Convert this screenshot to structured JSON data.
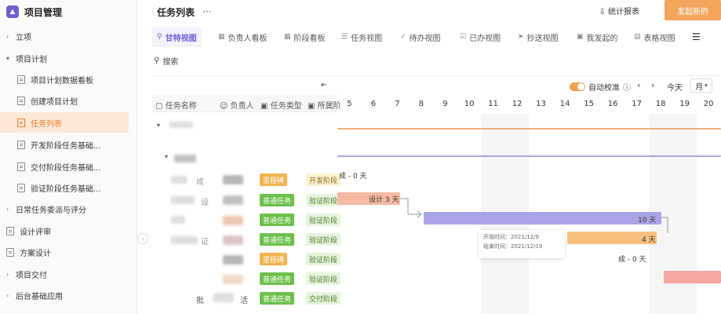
{
  "sidebar": {
    "title": "项目管理",
    "items": [
      {
        "label": "立项"
      },
      {
        "label": "项目计划"
      },
      {
        "label": "项目计划数据看板"
      },
      {
        "label": "创建项目计划"
      },
      {
        "label": "任务列表"
      },
      {
        "label": "开发阶段任务基础..."
      },
      {
        "label": "交付阶段任务基础..."
      },
      {
        "label": "验证阶段任务基础..."
      },
      {
        "label": "日常任务委派与评分"
      },
      {
        "label": "设计评审"
      },
      {
        "label": "方案设计"
      },
      {
        "label": "项目交付"
      },
      {
        "label": "后台基础应用"
      }
    ]
  },
  "header": {
    "title": "任务列表",
    "more": "···",
    "stat_label": "统计报表",
    "launch_label": "发起新的"
  },
  "tabs": [
    {
      "label": "甘特视图"
    },
    {
      "label": "负责人看板"
    },
    {
      "label": "阶段看板"
    },
    {
      "label": "任务视图"
    },
    {
      "label": "待办视图"
    },
    {
      "label": "已办视图"
    },
    {
      "label": "抄送视图"
    },
    {
      "label": "我发起的"
    },
    {
      "label": "表格视图"
    }
  ],
  "search": {
    "label": "搜索"
  },
  "table": {
    "headers": [
      "任务名称",
      "负责人",
      "任务类型",
      "所属阶"
    ],
    "rows": [
      {
        "type": "里程碑",
        "phase": "开发阶段"
      },
      {
        "type": "普通任务",
        "phase": "验证阶段"
      },
      {
        "type": "普通任务",
        "phase": "验证阶段"
      },
      {
        "type": "普通任务",
        "phase": "验证阶段"
      },
      {
        "type": "里程碑",
        "phase": "验证阶段"
      },
      {
        "type": "普通任务",
        "phase": "验证阶段"
      },
      {
        "type": "普通任务",
        "phase": "交付阶段"
      }
    ],
    "fragments": {
      "r1": "成",
      "r2": "设",
      "r3": "证",
      "r5": "批",
      "r6": "活"
    }
  },
  "gantt": {
    "auto_calibrate": "自动校准",
    "today": "今天",
    "month": "月",
    "days": [
      "5",
      "6",
      "7",
      "8",
      "9",
      "10",
      "11",
      "12",
      "13",
      "14",
      "15",
      "16",
      "17",
      "18",
      "19",
      "20"
    ],
    "labels": {
      "a": "成 - 0 天",
      "b": "设计 3 天",
      "c": "10 天",
      "d": "4 天",
      "e": "成 - 0 天"
    },
    "tooltip": {
      "start": "开始时间：2021/12/9",
      "end": "结束时间：2021/12/19"
    }
  }
}
